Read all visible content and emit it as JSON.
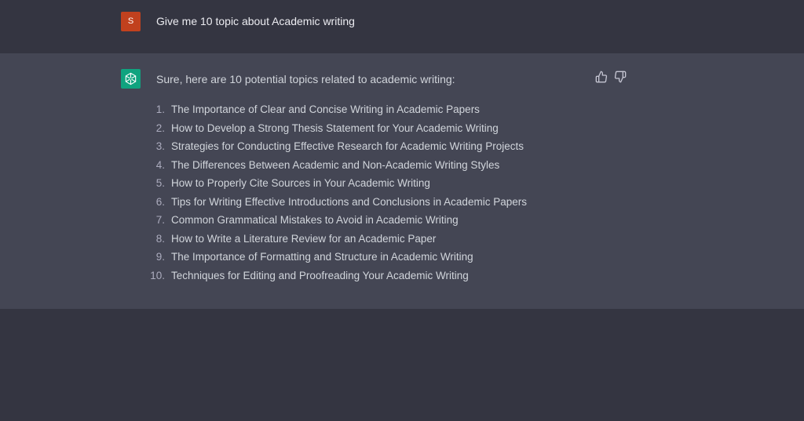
{
  "user_message": {
    "avatar_letter": "S",
    "text": "Give me 10 topic about Academic writing"
  },
  "assistant_message": {
    "intro": "Sure, here are 10 potential topics related to academic writing:",
    "topics": [
      {
        "num": "1.",
        "text": "The Importance of Clear and Concise Writing in Academic Papers"
      },
      {
        "num": "2.",
        "text": "How to Develop a Strong Thesis Statement for Your Academic Writing"
      },
      {
        "num": "3.",
        "text": "Strategies for Conducting Effective Research for Academic Writing Projects"
      },
      {
        "num": "4.",
        "text": "The Differences Between Academic and Non-Academic Writing Styles"
      },
      {
        "num": "5.",
        "text": "How to Properly Cite Sources in Your Academic Writing"
      },
      {
        "num": "6.",
        "text": "Tips for Writing Effective Introductions and Conclusions in Academic Papers"
      },
      {
        "num": "7.",
        "text": "Common Grammatical Mistakes to Avoid in Academic Writing"
      },
      {
        "num": "8.",
        "text": "How to Write a Literature Review for an Academic Paper"
      },
      {
        "num": "9.",
        "text": "The Importance of Formatting and Structure in Academic Writing"
      },
      {
        "num": "10.",
        "text": "Techniques for Editing and Proofreading Your Academic Writing"
      }
    ]
  },
  "icons": {
    "assistant_avatar": "openai-logo-icon",
    "feedback_positive": "thumbs-up-icon",
    "feedback_negative": "thumbs-down-icon"
  },
  "colors": {
    "background": "#343541",
    "assistant_background": "#444654",
    "user_avatar": "#c1411e",
    "assistant_avatar": "#10a37f"
  }
}
